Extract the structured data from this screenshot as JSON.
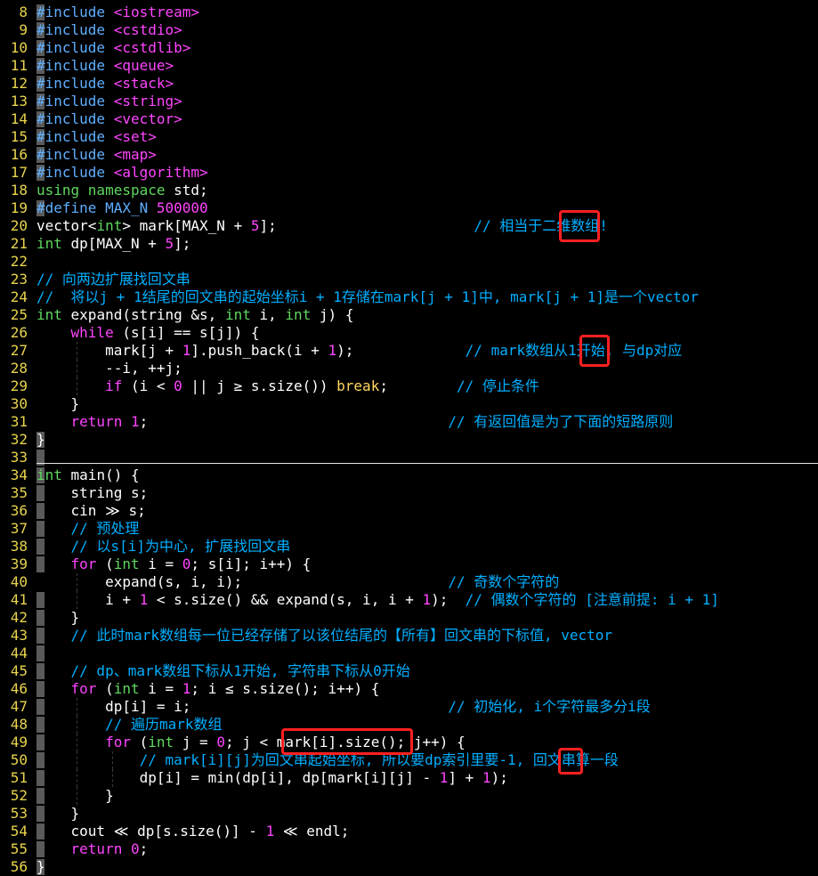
{
  "colors": {
    "background": "#000000",
    "line_number": "#e8d44d",
    "sign_column": "#5a5a5a",
    "default": "#ffffff",
    "preproc": "#5fafff",
    "header": "#ff45ff",
    "keyword": "#ff45ff",
    "keyword2": "#ffd75f",
    "type": "#5fd75f",
    "number": "#ff45ff",
    "comment": "#00afff",
    "highlight_box": "#ff2020"
  },
  "lines": [
    {
      "n": "8",
      "tokens": [
        [
          "#include",
          "p"
        ],
        [
          " ",
          ""
        ],
        [
          "<iostream>",
          "s"
        ]
      ]
    },
    {
      "n": "9",
      "tokens": [
        [
          "#include",
          "p"
        ],
        [
          " ",
          ""
        ],
        [
          "<cstdio>",
          "s"
        ]
      ]
    },
    {
      "n": "10",
      "tokens": [
        [
          "#include",
          "p"
        ],
        [
          " ",
          ""
        ],
        [
          "<cstdlib>",
          "s"
        ]
      ]
    },
    {
      "n": "11",
      "tokens": [
        [
          "#include",
          "p"
        ],
        [
          " ",
          ""
        ],
        [
          "<queue>",
          "s"
        ]
      ]
    },
    {
      "n": "12",
      "tokens": [
        [
          "#include",
          "p"
        ],
        [
          " ",
          ""
        ],
        [
          "<stack>",
          "s"
        ]
      ]
    },
    {
      "n": "13",
      "tokens": [
        [
          "#include",
          "p"
        ],
        [
          " ",
          ""
        ],
        [
          "<string>",
          "s"
        ]
      ]
    },
    {
      "n": "14",
      "tokens": [
        [
          "#include",
          "p"
        ],
        [
          " ",
          ""
        ],
        [
          "<vector>",
          "s"
        ]
      ]
    },
    {
      "n": "15",
      "tokens": [
        [
          "#include",
          "p"
        ],
        [
          " ",
          ""
        ],
        [
          "<set>",
          "s"
        ]
      ]
    },
    {
      "n": "16",
      "tokens": [
        [
          "#include",
          "p"
        ],
        [
          " ",
          ""
        ],
        [
          "<map>",
          "s"
        ]
      ]
    },
    {
      "n": "17",
      "tokens": [
        [
          "#include",
          "p"
        ],
        [
          " ",
          ""
        ],
        [
          "<algorithm>",
          "s"
        ]
      ]
    },
    {
      "n": "18",
      "tokens": [
        [
          "using namespace",
          "t"
        ],
        [
          " std;",
          ""
        ]
      ]
    },
    {
      "n": "19",
      "tokens": [
        [
          "#define MAX_N",
          "p"
        ],
        [
          " ",
          ""
        ],
        [
          "500000",
          "n"
        ]
      ]
    },
    {
      "n": "20",
      "tokens": [
        [
          "vector<",
          ""
        ],
        [
          "int",
          "t"
        ],
        [
          "> mark[MAX_N + ",
          ""
        ],
        [
          "5",
          "n"
        ],
        [
          "];                       ",
          ""
        ],
        [
          "// 相当于二维数组!",
          "c"
        ]
      ]
    },
    {
      "n": "21",
      "tokens": [
        [
          "int",
          "t"
        ],
        [
          " dp[MAX_N + ",
          ""
        ],
        [
          "5",
          "n"
        ],
        [
          "];",
          ""
        ]
      ]
    },
    {
      "n": "22",
      "tokens": []
    },
    {
      "n": "23",
      "tokens": [
        [
          "// 向两边扩展找回文串",
          "c"
        ]
      ]
    },
    {
      "n": "24",
      "tokens": [
        [
          "//  将以j + 1结尾的回文串的起始坐标i + 1存储在mark[j + 1]中, mark[j + 1]是一个vector",
          "c"
        ]
      ]
    },
    {
      "n": "25",
      "tokens": [
        [
          "int",
          "t"
        ],
        [
          " expand(string &s, ",
          ""
        ],
        [
          "int",
          "t"
        ],
        [
          " i, ",
          ""
        ],
        [
          "int",
          "t"
        ],
        [
          " j) {",
          ""
        ]
      ]
    },
    {
      "n": "26",
      "tokens": [
        [
          "    ",
          ""
        ],
        [
          "while",
          "k"
        ],
        [
          " (s[i] == s[j]) {",
          ""
        ]
      ]
    },
    {
      "n": "27",
      "tokens": [
        [
          "        mark[j + ",
          ""
        ],
        [
          "1",
          "n"
        ],
        [
          "].push_back(i + ",
          ""
        ],
        [
          "1",
          "n"
        ],
        [
          ");             ",
          ""
        ],
        [
          "// mark数组从1开始, 与dp对应",
          "c"
        ]
      ]
    },
    {
      "n": "28",
      "tokens": [
        [
          "        --i, ++j;",
          ""
        ]
      ]
    },
    {
      "n": "29",
      "tokens": [
        [
          "        ",
          ""
        ],
        [
          "if",
          "k"
        ],
        [
          " (i < ",
          ""
        ],
        [
          "0",
          "n"
        ],
        [
          " || j ≥ s.size()) ",
          ""
        ],
        [
          "break",
          "k2"
        ],
        [
          ";        ",
          ""
        ],
        [
          "// 停止条件",
          "c"
        ]
      ]
    },
    {
      "n": "30",
      "tokens": [
        [
          "    }",
          ""
        ]
      ]
    },
    {
      "n": "31",
      "tokens": [
        [
          "    ",
          ""
        ],
        [
          "return",
          "k"
        ],
        [
          " ",
          ""
        ],
        [
          "1",
          "n"
        ],
        [
          ";                                   ",
          ""
        ],
        [
          "// 有返回值是为了下面的短路原则",
          "c"
        ]
      ]
    },
    {
      "n": "32",
      "tokens": [
        [
          "}",
          ""
        ]
      ]
    },
    {
      "n": "33",
      "tokens": []
    },
    {
      "n": "34",
      "tokens": [
        [
          "int",
          "t"
        ],
        [
          " main() {",
          ""
        ]
      ]
    },
    {
      "n": "35",
      "tokens": [
        [
          "    string s;",
          ""
        ]
      ]
    },
    {
      "n": "36",
      "tokens": [
        [
          "    cin ≫ s;",
          ""
        ]
      ]
    },
    {
      "n": "37",
      "tokens": [
        [
          "    ",
          ""
        ],
        [
          "// 预处理",
          "c"
        ]
      ]
    },
    {
      "n": "38",
      "tokens": [
        [
          "    ",
          ""
        ],
        [
          "// 以s[i]为中心, 扩展找回文串",
          "c"
        ]
      ]
    },
    {
      "n": "39",
      "tokens": [
        [
          "    ",
          ""
        ],
        [
          "for",
          "k"
        ],
        [
          " (",
          ""
        ],
        [
          "int",
          "t"
        ],
        [
          " i = ",
          ""
        ],
        [
          "0",
          "n"
        ],
        [
          "; s[i]; i++) {",
          ""
        ]
      ]
    },
    {
      "n": "40",
      "tokens": [
        [
          "        expand(s, i, i);                        ",
          ""
        ],
        [
          "// 奇数个字符的",
          "c"
        ]
      ]
    },
    {
      "n": "41",
      "tokens": [
        [
          "        i + ",
          ""
        ],
        [
          "1",
          "n"
        ],
        [
          " < s.size() && expand(s, i, i + ",
          ""
        ],
        [
          "1",
          "n"
        ],
        [
          ");  ",
          ""
        ],
        [
          "// 偶数个字符的 [注意前提: i + 1]",
          "c"
        ]
      ]
    },
    {
      "n": "42",
      "tokens": [
        [
          "    }",
          ""
        ]
      ]
    },
    {
      "n": "43",
      "tokens": [
        [
          "    ",
          ""
        ],
        [
          "// 此时mark数组每一位已经存储了以该位结尾的【所有】回文串的下标值, vector",
          "c"
        ]
      ]
    },
    {
      "n": "44",
      "tokens": []
    },
    {
      "n": "45",
      "tokens": [
        [
          "    ",
          ""
        ],
        [
          "// dp、mark数组下标从1开始, 字符串下标从0开始",
          "c"
        ]
      ]
    },
    {
      "n": "46",
      "tokens": [
        [
          "    ",
          ""
        ],
        [
          "for",
          "k"
        ],
        [
          " (",
          ""
        ],
        [
          "int",
          "t"
        ],
        [
          " i = ",
          ""
        ],
        [
          "1",
          "n"
        ],
        [
          "; i ≤ s.size(); i++) {",
          ""
        ]
      ]
    },
    {
      "n": "47",
      "tokens": [
        [
          "        dp[i] = i;                              ",
          ""
        ],
        [
          "// 初始化, i个字符最多分i段",
          "c"
        ]
      ]
    },
    {
      "n": "48",
      "tokens": [
        [
          "        ",
          ""
        ],
        [
          "// 遍历mark数组",
          "c"
        ]
      ]
    },
    {
      "n": "49",
      "tokens": [
        [
          "        ",
          ""
        ],
        [
          "for",
          "k"
        ],
        [
          " (",
          ""
        ],
        [
          "int",
          "t"
        ],
        [
          " j = ",
          ""
        ],
        [
          "0",
          "n"
        ],
        [
          "; j < mark[i].size(); j++) {",
          ""
        ]
      ]
    },
    {
      "n": "50",
      "tokens": [
        [
          "            ",
          ""
        ],
        [
          "// mark[i][j]为回文串起始坐标, 所以要dp索引里要-1, 回文串算一段",
          "c"
        ]
      ]
    },
    {
      "n": "51",
      "tokens": [
        [
          "            dp[i] = min(dp[i], dp[mark[i][j] - ",
          ""
        ],
        [
          "1",
          "n"
        ],
        [
          "] + ",
          ""
        ],
        [
          "1",
          "n"
        ],
        [
          ");",
          ""
        ]
      ]
    },
    {
      "n": "52",
      "tokens": [
        [
          "        }",
          ""
        ]
      ]
    },
    {
      "n": "53",
      "tokens": [
        [
          "    }",
          ""
        ]
      ]
    },
    {
      "n": "54",
      "tokens": [
        [
          "    cout ≪ dp[s.size()] - ",
          ""
        ],
        [
          "1",
          "n"
        ],
        [
          " ≪ endl;",
          ""
        ]
      ]
    },
    {
      "n": "55",
      "tokens": [
        [
          "    ",
          ""
        ],
        [
          "return",
          "k"
        ],
        [
          " ",
          ""
        ],
        [
          "0",
          "n"
        ],
        [
          ";",
          ""
        ]
      ]
    },
    {
      "n": "56",
      "tokens": [
        [
          "}",
          ""
        ]
      ]
    }
  ]
}
